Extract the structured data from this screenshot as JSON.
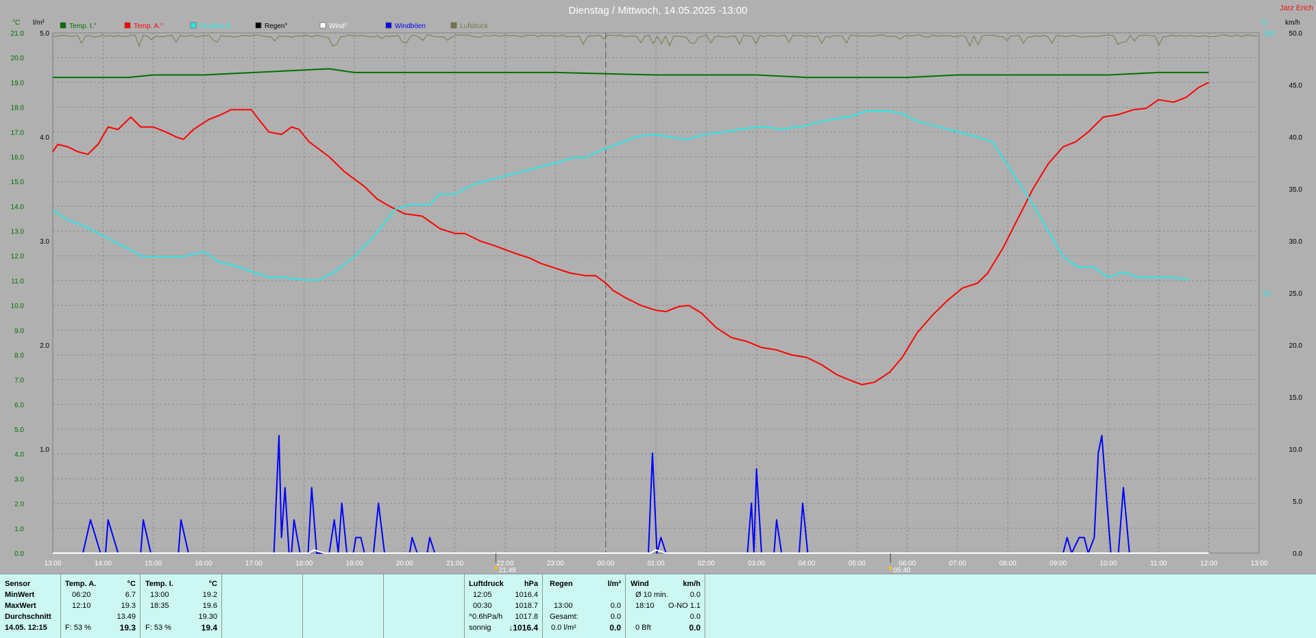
{
  "header": {
    "title": "Dienstag / Mittwoch, 14.05.2025  -13:00",
    "author": "Jarz Erich"
  },
  "axes": {
    "left_unit": "°C",
    "rain_unit": "l/m²",
    "right_unit_pct": "%",
    "right_unit_wind": "km/h",
    "temp_ticks": [
      "0.0",
      "1.0",
      "2.0",
      "3.0",
      "4.0",
      "5.0",
      "6.0",
      "7.0",
      "8.0",
      "9.0",
      "10.0",
      "11.0",
      "12.0",
      "13.0",
      "14.0",
      "15.0",
      "16.0",
      "17.0",
      "18.0",
      "19.0",
      "20.0",
      "21.0"
    ],
    "rain_ticks": [
      "1.0",
      "2.0",
      "3.0",
      "4.0",
      "5.0"
    ],
    "pct_ticks": [
      "50",
      "100"
    ],
    "wind_ticks": [
      "0.0",
      "5.0",
      "10.0",
      "15.0",
      "20.0",
      "25.0",
      "30.0",
      "35.0",
      "40.0",
      "45.0",
      "50.0"
    ],
    "time_ticks": [
      "13:00",
      "14:00",
      "15:00",
      "16:00",
      "17:00",
      "18:00",
      "19:00",
      "20:00",
      "21:00",
      "22:00",
      "23:00",
      "00:00",
      "01:00",
      "02:00",
      "03:00",
      "04:00",
      "05:00",
      "06:00",
      "07:00",
      "08:00",
      "09:00",
      "10:00",
      "11:00",
      "12:00",
      "13:00"
    ],
    "sunset": "21:49",
    "sunrise": "05:40"
  },
  "legend": [
    {
      "label": "Temp. I.°",
      "color": "#007000"
    },
    {
      "label": "Temp. A.°",
      "color": "#ff0000"
    },
    {
      "label": "Feuchte A.",
      "color": "#28e8e8"
    },
    {
      "label": "Regen°",
      "color": "#000000"
    },
    {
      "label": "Wind°",
      "color": "#ffffff"
    },
    {
      "label": "Windböen",
      "color": "#0000ff"
    },
    {
      "label": "Luftdruck",
      "color": "#78784a"
    }
  ],
  "chart_data": {
    "type": "line",
    "x_unit": "hours since 13:00",
    "x_range": [
      0,
      24
    ],
    "temp_range": [
      0,
      21
    ],
    "humidity_range": [
      0,
      100
    ],
    "wind_range": [
      0,
      50
    ],
    "series": [
      {
        "name": "Temp. A.°",
        "axis": "temp",
        "color": "#ff0000",
        "points": [
          [
            0,
            16.2
          ],
          [
            0.1,
            16.5
          ],
          [
            0.3,
            16.4
          ],
          [
            0.5,
            16.2
          ],
          [
            0.7,
            16.1
          ],
          [
            0.9,
            16.5
          ],
          [
            1.1,
            17.2
          ],
          [
            1.3,
            17.1
          ],
          [
            1.55,
            17.6
          ],
          [
            1.75,
            17.2
          ],
          [
            2,
            17.2
          ],
          [
            2.25,
            17.0
          ],
          [
            2.45,
            16.8
          ],
          [
            2.6,
            16.7
          ],
          [
            2.8,
            17.1
          ],
          [
            3.1,
            17.5
          ],
          [
            3.35,
            17.7
          ],
          [
            3.55,
            17.9
          ],
          [
            3.75,
            17.9
          ],
          [
            3.95,
            17.9
          ],
          [
            4.1,
            17.5
          ],
          [
            4.3,
            17.0
          ],
          [
            4.55,
            16.9
          ],
          [
            4.75,
            17.2
          ],
          [
            4.9,
            17.1
          ],
          [
            5.1,
            16.6
          ],
          [
            5.5,
            16.0
          ],
          [
            5.8,
            15.4
          ],
          [
            6.2,
            14.8
          ],
          [
            6.45,
            14.3
          ],
          [
            6.7,
            14.0
          ],
          [
            7.0,
            13.7
          ],
          [
            7.35,
            13.6
          ],
          [
            7.7,
            13.1
          ],
          [
            8.0,
            12.9
          ],
          [
            8.2,
            12.9
          ],
          [
            8.5,
            12.6
          ],
          [
            8.8,
            12.4
          ],
          [
            9.2,
            12.1
          ],
          [
            9.5,
            11.9
          ],
          [
            9.7,
            11.7
          ],
          [
            10.0,
            11.5
          ],
          [
            10.3,
            11.3
          ],
          [
            10.6,
            11.2
          ],
          [
            10.8,
            11.2
          ],
          [
            11.0,
            10.9
          ],
          [
            11.15,
            10.6
          ],
          [
            11.4,
            10.3
          ],
          [
            11.7,
            10.0
          ],
          [
            12.0,
            9.8
          ],
          [
            12.2,
            9.75
          ],
          [
            12.45,
            9.95
          ],
          [
            12.65,
            10.0
          ],
          [
            12.9,
            9.7
          ],
          [
            13.2,
            9.1
          ],
          [
            13.5,
            8.7
          ],
          [
            13.8,
            8.55
          ],
          [
            14.1,
            8.3
          ],
          [
            14.4,
            8.2
          ],
          [
            14.7,
            8.0
          ],
          [
            15.0,
            7.9
          ],
          [
            15.3,
            7.6
          ],
          [
            15.6,
            7.2
          ],
          [
            15.9,
            6.95
          ],
          [
            16.1,
            6.8
          ],
          [
            16.35,
            6.9
          ],
          [
            16.65,
            7.3
          ],
          [
            16.9,
            7.9
          ],
          [
            17.2,
            8.9
          ],
          [
            17.5,
            9.6
          ],
          [
            17.8,
            10.2
          ],
          [
            18.1,
            10.7
          ],
          [
            18.4,
            10.9
          ],
          [
            18.6,
            11.3
          ],
          [
            18.9,
            12.3
          ],
          [
            19.2,
            13.5
          ],
          [
            19.5,
            14.7
          ],
          [
            19.8,
            15.7
          ],
          [
            20.1,
            16.4
          ],
          [
            20.35,
            16.6
          ],
          [
            20.6,
            17.0
          ],
          [
            20.9,
            17.6
          ],
          [
            21.2,
            17.7
          ],
          [
            21.5,
            17.9
          ],
          [
            21.75,
            17.95
          ],
          [
            22.0,
            18.3
          ],
          [
            22.3,
            18.2
          ],
          [
            22.55,
            18.4
          ],
          [
            22.8,
            18.8
          ],
          [
            23.0,
            19.0
          ]
        ]
      },
      {
        "name": "Temp. I.°",
        "axis": "temp",
        "color": "#007000",
        "points": [
          [
            0,
            19.2
          ],
          [
            1.5,
            19.2
          ],
          [
            2,
            19.3
          ],
          [
            3,
            19.3
          ],
          [
            4,
            19.4
          ],
          [
            5,
            19.5
          ],
          [
            5.5,
            19.55
          ],
          [
            6,
            19.4
          ],
          [
            8,
            19.4
          ],
          [
            10,
            19.4
          ],
          [
            12,
            19.3
          ],
          [
            14,
            19.3
          ],
          [
            15,
            19.2
          ],
          [
            16,
            19.2
          ],
          [
            17,
            19.2
          ],
          [
            18,
            19.3
          ],
          [
            21,
            19.3
          ],
          [
            22,
            19.4
          ],
          [
            23,
            19.4
          ]
        ]
      },
      {
        "name": "Feuchte A.",
        "axis": "humidity",
        "color": "#28e8e8",
        "points": [
          [
            0,
            66
          ],
          [
            0.3,
            64
          ],
          [
            0.6,
            63
          ],
          [
            1.0,
            61
          ],
          [
            1.4,
            59
          ],
          [
            1.8,
            57
          ],
          [
            2.2,
            57
          ],
          [
            2.6,
            57
          ],
          [
            3.0,
            58
          ],
          [
            3.3,
            56
          ],
          [
            3.7,
            55
          ],
          [
            4.0,
            54
          ],
          [
            4.3,
            53
          ],
          [
            4.6,
            53
          ],
          [
            5.0,
            52.5
          ],
          [
            5.3,
            52.5
          ],
          [
            5.6,
            54
          ],
          [
            6.0,
            57
          ],
          [
            6.4,
            61
          ],
          [
            6.8,
            66
          ],
          [
            7.1,
            67
          ],
          [
            7.5,
            67
          ],
          [
            7.7,
            69
          ],
          [
            8.0,
            69
          ],
          [
            8.4,
            71
          ],
          [
            8.8,
            72
          ],
          [
            9.2,
            73
          ],
          [
            9.6,
            74
          ],
          [
            10.0,
            75
          ],
          [
            10.35,
            76
          ],
          [
            10.6,
            76
          ],
          [
            10.8,
            77
          ],
          [
            11.2,
            78.5
          ],
          [
            11.6,
            80
          ],
          [
            11.9,
            80.5
          ],
          [
            12.3,
            80
          ],
          [
            12.6,
            79.5
          ],
          [
            13.0,
            80.5
          ],
          [
            13.4,
            81
          ],
          [
            13.7,
            81.5
          ],
          [
            14.1,
            82
          ],
          [
            14.5,
            81.5
          ],
          [
            14.9,
            82
          ],
          [
            15.3,
            83
          ],
          [
            15.6,
            83.5
          ],
          [
            15.9,
            84
          ],
          [
            16.2,
            85
          ],
          [
            16.6,
            85
          ],
          [
            16.9,
            84.5
          ],
          [
            17.2,
            83
          ],
          [
            17.6,
            82
          ],
          [
            18.0,
            81
          ],
          [
            18.4,
            80
          ],
          [
            18.7,
            79
          ],
          [
            19.1,
            73
          ],
          [
            19.5,
            67
          ],
          [
            19.8,
            62
          ],
          [
            20.1,
            57
          ],
          [
            20.4,
            55
          ],
          [
            20.7,
            55
          ],
          [
            21.0,
            53
          ],
          [
            21.3,
            54
          ],
          [
            21.6,
            53
          ],
          [
            22.0,
            53
          ],
          [
            22.3,
            53
          ],
          [
            22.6,
            52.5
          ]
        ]
      },
      {
        "name": "Windböen",
        "axis": "wind",
        "color": "#0000ff",
        "points": [
          [
            0,
            0
          ],
          [
            0.6,
            0
          ],
          [
            0.75,
            3.2
          ],
          [
            0.95,
            0
          ],
          [
            1.05,
            0
          ],
          [
            1.1,
            3.2
          ],
          [
            1.3,
            0
          ],
          [
            1.75,
            0
          ],
          [
            1.8,
            3.2
          ],
          [
            1.95,
            0
          ],
          [
            2.5,
            0
          ],
          [
            2.55,
            3.2
          ],
          [
            2.7,
            0
          ],
          [
            4.4,
            0
          ],
          [
            4.5,
            11.3
          ],
          [
            4.55,
            1.5
          ],
          [
            4.62,
            6.3
          ],
          [
            4.7,
            0
          ],
          [
            4.75,
            0
          ],
          [
            4.8,
            3.2
          ],
          [
            4.92,
            0
          ],
          [
            5.08,
            0
          ],
          [
            5.15,
            6.3
          ],
          [
            5.25,
            0
          ],
          [
            5.5,
            0
          ],
          [
            5.6,
            3.2
          ],
          [
            5.68,
            0
          ],
          [
            5.75,
            4.8
          ],
          [
            5.85,
            0
          ],
          [
            5.98,
            0
          ],
          [
            6.03,
            1.5
          ],
          [
            6.13,
            1.5
          ],
          [
            6.2,
            0
          ],
          [
            6.38,
            0
          ],
          [
            6.48,
            4.8
          ],
          [
            6.6,
            0
          ],
          [
            7.1,
            0
          ],
          [
            7.15,
            1.5
          ],
          [
            7.25,
            0
          ],
          [
            7.45,
            0
          ],
          [
            7.5,
            1.5
          ],
          [
            7.6,
            0
          ],
          [
            11.85,
            0
          ],
          [
            11.93,
            9.6
          ],
          [
            12.02,
            0
          ],
          [
            12.1,
            1.5
          ],
          [
            12.2,
            0
          ],
          [
            13.82,
            0
          ],
          [
            13.9,
            4.8
          ],
          [
            13.95,
            0
          ],
          [
            14.0,
            8.1
          ],
          [
            14.1,
            0
          ],
          [
            14.35,
            0
          ],
          [
            14.4,
            3.2
          ],
          [
            14.5,
            0
          ],
          [
            14.85,
            0
          ],
          [
            14.92,
            4.8
          ],
          [
            15.02,
            0
          ],
          [
            20.1,
            0
          ],
          [
            20.18,
            1.5
          ],
          [
            20.27,
            0
          ],
          [
            20.42,
            1.5
          ],
          [
            20.52,
            1.5
          ],
          [
            20.6,
            0
          ],
          [
            20.72,
            1.5
          ],
          [
            20.8,
            9.6
          ],
          [
            20.87,
            11.3
          ],
          [
            20.95,
            6.3
          ],
          [
            21.05,
            0
          ],
          [
            21.2,
            0
          ],
          [
            21.3,
            6.3
          ],
          [
            21.42,
            0
          ],
          [
            23.0,
            0
          ]
        ]
      },
      {
        "name": "Wind°",
        "axis": "wind",
        "color": "#ffffff",
        "points": [
          [
            0,
            0
          ],
          [
            5.1,
            0
          ],
          [
            5.2,
            0.3
          ],
          [
            5.4,
            0
          ],
          [
            11.9,
            0
          ],
          [
            12.0,
            0.3
          ],
          [
            12.2,
            0
          ],
          [
            23.0,
            0
          ]
        ]
      }
    ]
  },
  "stats": {
    "sensor": {
      "head": "Sensor",
      "rows": [
        "MinWert",
        "MaxWert",
        "Durchschnitt",
        "14.05. 12:15"
      ]
    },
    "temp_a": {
      "head": "Temp. A.",
      "unit": "°C",
      "min_time": "06:20",
      "min": "6.7",
      "max_time": "12:10",
      "max": "19.3",
      "avg": "13.49",
      "hum": "F: 53 %",
      "current": "19.3"
    },
    "temp_i": {
      "head": "Temp. I.",
      "unit": "°C",
      "min_time": "13:00",
      "min": "19.2",
      "max_time": "18:35",
      "max": "19.6",
      "avg": "19.30",
      "hum": "F: 53 %",
      "current": "19.4"
    },
    "pressure": {
      "head": "Luftdruck",
      "unit": "hPa",
      "min_time": "12:05",
      "min": "1016.4",
      "max_time": "00:30",
      "max": "1018.7",
      "trend": "^0.6hPa/h",
      "avg": "1017.8",
      "forecast": "sonnig",
      "current": "↓1016.4"
    },
    "rain": {
      "head": "Regen",
      "unit": "l/m²",
      "max_time": "13:00",
      "max": "0.0",
      "total_label": "Gesamt:",
      "total": "0.0",
      "current_rate": "0.0 l/m²",
      "current": "0.0"
    },
    "wind": {
      "head": "Wind",
      "unit": "km/h",
      "avg_label": "Ø 10 min.",
      "avg": "0.0",
      "max_time": "18:10",
      "max": "O-NO 1.1",
      "mean": "0.0",
      "bft": "0 Bft",
      "current": "0.0"
    }
  }
}
